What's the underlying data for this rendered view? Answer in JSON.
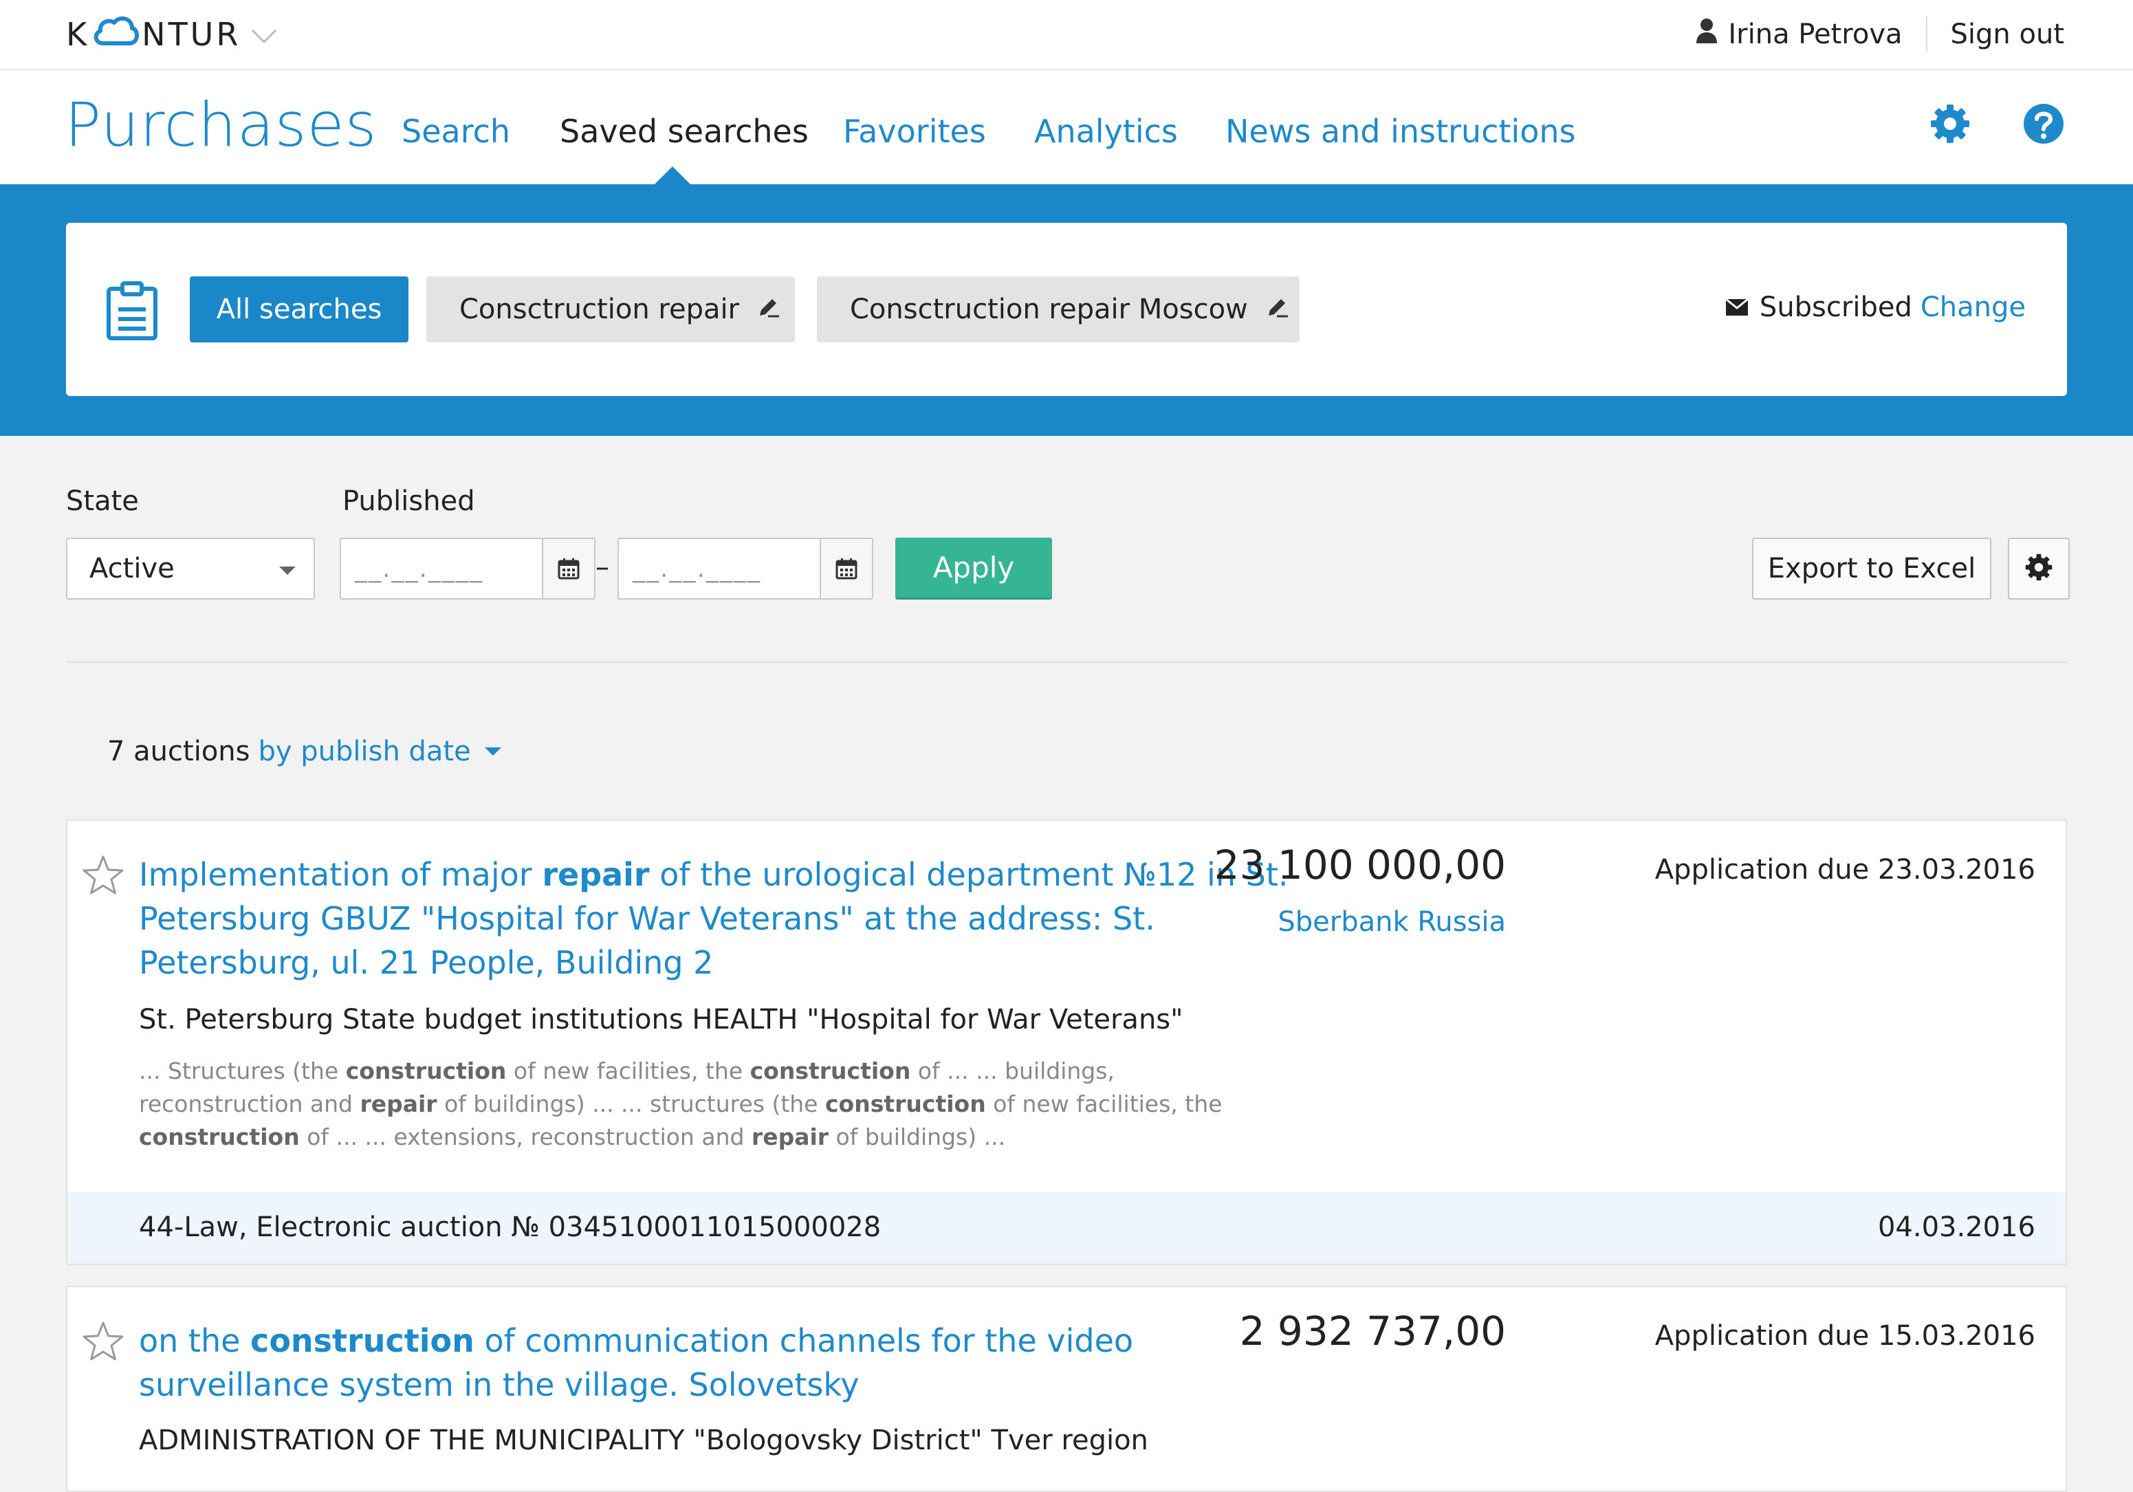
{
  "header": {
    "logo": {
      "before": "K",
      "after": "NTUR"
    },
    "user_name": "Irina Petrova",
    "sign_out": "Sign out"
  },
  "nav": {
    "app_title": "Purchases",
    "items": [
      {
        "label": "Search",
        "active": false
      },
      {
        "label": "Saved searches",
        "active": true
      },
      {
        "label": "Favorites",
        "active": false
      },
      {
        "label": "Analytics",
        "active": false
      },
      {
        "label": "News and instructions",
        "active": false
      }
    ],
    "icons": [
      "gear-icon",
      "help-icon"
    ]
  },
  "saved_searches": {
    "chips": [
      {
        "label": "All searches",
        "active": true
      },
      {
        "label": "Consctruction repair",
        "active": false
      },
      {
        "label": "Consctruction repair Moscow",
        "active": false
      }
    ],
    "subscribed_label": "Subscribed",
    "change_label": "Change"
  },
  "filters": {
    "state_label": "State",
    "state_value": "Active",
    "published_label": "Published",
    "date_from_placeholder": "__.__.____",
    "date_to_placeholder": "__.__.____",
    "date_separator": "–",
    "apply_label": "Apply",
    "export_label": "Export to Excel"
  },
  "results": {
    "count_text": "7 auctions",
    "sort_label": "by publish date",
    "items": [
      {
        "title_parts": [
          "Implementation of major ",
          "repair",
          " of the urological department №12 in St. Petersburg GBUZ \"Hospital for War Veterans\" at the address: St. Petersburg, ul. 21 People, Building 2"
        ],
        "organization": "St. Petersburg State budget institutions HEALTH \"Hospital for War Veterans\"",
        "snippet_parts": [
          "... Structures (the ",
          "construction",
          " of new facilities, the ",
          "construction",
          " of ... ... buildings, reconstruction and ",
          "repair",
          " of buildings) ... ... structures (the ",
          "construction",
          " of new facilities, the ",
          "construction",
          " of ... ... extensions, reconstruction and ",
          "repair",
          " of buildings) ..."
        ],
        "price": "23 100 000,00",
        "bank": "Sberbank Russia",
        "due": "Application due 23.03.2016",
        "law": "44-Law, Electronic auction № 0345100011015000028",
        "date": "04.03.2016"
      },
      {
        "title_parts": [
          "on the ",
          "construction",
          " of communication channels for the video surveillance system in the village. Solovetsky"
        ],
        "organization": "ADMINISTRATION OF THE MUNICIPALITY \"Bologovsky District\" Tver region",
        "price": "2 932 737,00",
        "due": "Application due 15.03.2016"
      }
    ]
  },
  "colors": {
    "accent": "#1e8acb",
    "band": "#1a87c9",
    "apply": "#35b594",
    "background": "#f2f2f2",
    "footer_row": "#eef5fc"
  }
}
